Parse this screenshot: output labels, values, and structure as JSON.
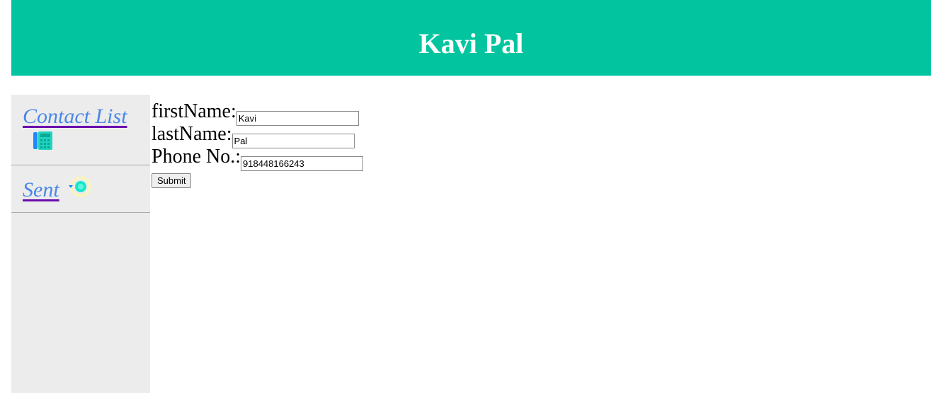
{
  "header": {
    "title": "Kavi Pal",
    "background_color": "#02c59f"
  },
  "sidebar": {
    "background_color": "#ececec",
    "items": [
      {
        "label": "Contact List",
        "icon": "telephone-icon"
      },
      {
        "label": "Sent",
        "icon": "sent-ring-icon"
      }
    ]
  },
  "form": {
    "first_name_label": "firstName:",
    "first_name_value": "Kavi",
    "last_name_label": "lastName:",
    "last_name_value": "Pal",
    "phone_label": "Phone No.:",
    "phone_value": "918448166243",
    "submit_label": "Submit"
  },
  "colors": {
    "link": "#4a86e8",
    "link_underline": "#6a0dad"
  }
}
